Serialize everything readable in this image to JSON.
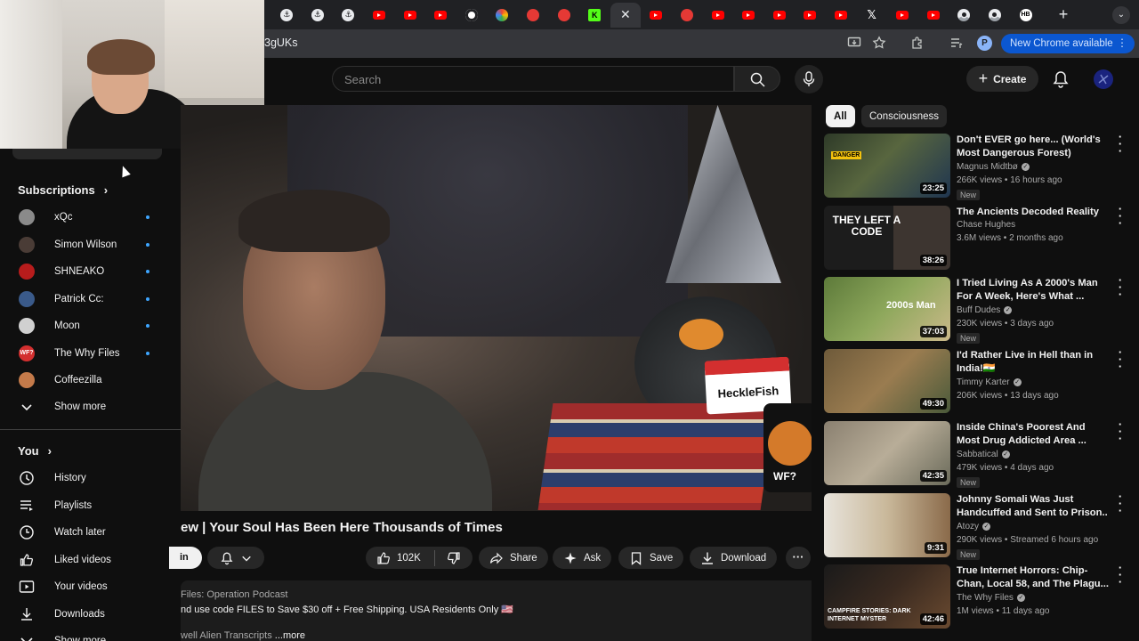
{
  "browser": {
    "tabs": [
      {
        "icon": "anchor-icon"
      },
      {
        "icon": "anchor-icon"
      },
      {
        "icon": "anchor-icon"
      },
      {
        "icon": "youtube-icon"
      },
      {
        "icon": "youtube-icon"
      },
      {
        "icon": "youtube-icon"
      },
      {
        "icon": "target-icon"
      },
      {
        "icon": "rainbow-icon"
      },
      {
        "icon": "red-power-icon"
      },
      {
        "icon": "red-power-icon"
      },
      {
        "icon": "kick-icon",
        "glyph": "K"
      },
      {
        "icon": "close-icon",
        "glyph": "✕",
        "active": true
      },
      {
        "icon": "youtube-icon"
      },
      {
        "icon": "red-dot-icon"
      },
      {
        "icon": "youtube-icon"
      },
      {
        "icon": "youtube-icon"
      },
      {
        "icon": "youtube-icon"
      },
      {
        "icon": "youtube-icon"
      },
      {
        "icon": "youtube-icon"
      },
      {
        "icon": "x-icon",
        "glyph": "𝕏"
      },
      {
        "icon": "youtube-icon"
      },
      {
        "icon": "youtube-icon"
      },
      {
        "icon": "chrome-icon"
      },
      {
        "icon": "chrome-icon"
      },
      {
        "icon": "hb-icon",
        "glyph": "HB"
      }
    ],
    "new_tab_glyph": "+",
    "tab_search_glyph": "⌄",
    "url": "3gUKs",
    "profile_initial": "P",
    "update_label": "New Chrome available",
    "update_menu_glyph": "⋮"
  },
  "youtube": {
    "search_placeholder": "Search",
    "create_label": "Create",
    "create_glyph": "+"
  },
  "sidebar": {
    "subscriptions_title": "Subscriptions",
    "chevron": "›",
    "channels": [
      {
        "name": "xQc",
        "avatar_color": "#8a8a8a",
        "new": true
      },
      {
        "name": "Simon Wilson",
        "avatar_color": "#4a3c36",
        "new": true
      },
      {
        "name": "SHNEAKO",
        "avatar_color": "#b71c1c",
        "new": true
      },
      {
        "name": "Patrick Cc:",
        "avatar_color": "#3a5a8a",
        "new": true
      },
      {
        "name": "Moon",
        "avatar_color": "#d0d0d0",
        "new": true
      },
      {
        "name": "The Why Files",
        "avatar_color": "#d32f2f",
        "avatar_text": "WF?",
        "new": true
      },
      {
        "name": "Coffeezilla",
        "avatar_color": "#c47a4a",
        "new": false
      }
    ],
    "show_more": "Show more",
    "you_title": "You",
    "you_items": [
      {
        "label": "History",
        "icon": "history-icon"
      },
      {
        "label": "Playlists",
        "icon": "playlists-icon"
      },
      {
        "label": "Watch later",
        "icon": "watch-later-icon"
      },
      {
        "label": "Liked videos",
        "icon": "liked-videos-icon"
      },
      {
        "label": "Your videos",
        "icon": "your-videos-icon"
      },
      {
        "label": "Downloads",
        "icon": "downloads-icon"
      },
      {
        "label": "Show more",
        "icon": "chevron-down-icon"
      }
    ]
  },
  "player": {
    "tag_text": "HeckleFish",
    "phone_logo": "WF?"
  },
  "video": {
    "title": "ew | Your Soul Has Been Here Thousands of Times",
    "subscribe_partial": "in",
    "likes": "102K",
    "share": "Share",
    "ask": "Ask",
    "save": "Save",
    "download": "Download",
    "more_glyph": "···",
    "desc_line1": "Files: Operation Podcast",
    "desc_line2": "nd use code FILES to Save $30 off + Free Shipping. USA Residents Only 🇺🇸",
    "desc_line3": "well Alien Transcripts",
    "desc_more": " ...more"
  },
  "chips": [
    "All",
    "Consciousness"
  ],
  "recommendations": [
    {
      "title": "Don't EVER go here... (World's Most Dangerous Forest)",
      "channel": "Magnus Midtbø",
      "verified": true,
      "meta": "266K views • 16 hours ago",
      "badge": "New",
      "duration": "23:25",
      "thumb": "linear-gradient(135deg,#2e3a28,#58663f 45%,#1f3550)",
      "thumb_text": "DANGER"
    },
    {
      "title": "The Ancients Decoded Reality",
      "channel": "Chase Hughes",
      "verified": false,
      "meta": "3.6M views • 2 months ago",
      "badge": "",
      "duration": "38:26",
      "thumb": "linear-gradient(90deg,#1c1c1c 0 55%,#3d3530 55%)",
      "thumb_text": "THEY LEFT A CODE"
    },
    {
      "title": "I Tried Living As A 2000's Man For A Week, Here's What ...",
      "channel": "Buff Dudes",
      "verified": true,
      "meta": "230K views • 3 days ago",
      "badge": "New",
      "duration": "37:03",
      "thumb": "linear-gradient(135deg,#5d7a3a,#8ea85c 50%,#cbb98a)",
      "thumb_text": "2000s Man"
    },
    {
      "title": "I'd Rather Live in Hell than in India!🇮🇳",
      "channel": "Timmy Karter",
      "verified": true,
      "meta": "206K views • 13 days ago",
      "badge": "",
      "duration": "49:30",
      "thumb": "linear-gradient(135deg,#6e5a3a,#9a7c50 50%,#4a5a3a)",
      "thumb_text": ""
    },
    {
      "title": "Inside China's Poorest And Most Drug Addicted Area ...",
      "channel": "Sabbatical",
      "verified": true,
      "meta": "479K views • 4 days ago",
      "badge": "New",
      "duration": "42:35",
      "thumb": "linear-gradient(135deg,#8a8070,#b8ad98 50%,#6a6a5a)",
      "thumb_text": ""
    },
    {
      "title": "Johnny Somali Was Just Handcuffed and Sent to Prison..",
      "channel": "Atozy",
      "verified": true,
      "meta": "290K views • Streamed 6 hours ago",
      "badge": "New",
      "duration": "9:31",
      "thumb": "linear-gradient(90deg,#e8e4dc,#c9b89a 50%,#8a6a4a)",
      "thumb_text": ""
    },
    {
      "title": "True Internet Horrors: Chip-Chan, Local 58, and The Plagu...",
      "channel": "The Why Files",
      "verified": true,
      "meta": "1M views • 11 days ago",
      "badge": "",
      "duration": "42:46",
      "thumb": "linear-gradient(135deg,#1a1a1a,#3a2a20 50%,#6a4a30)",
      "thumb_text": "CAMPFIRE STORIES: DARK INTERNET MYSTER"
    }
  ]
}
